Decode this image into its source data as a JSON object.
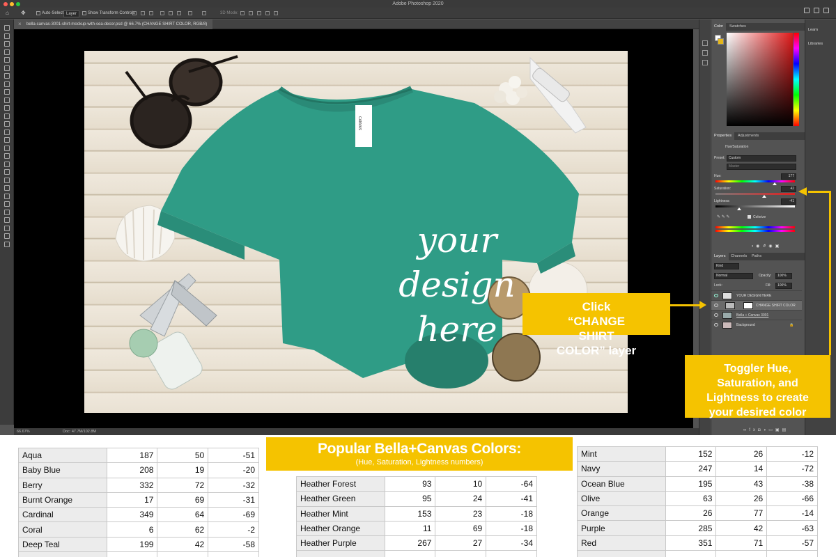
{
  "app": {
    "window_title": "Adobe Photoshop 2020",
    "options_bar": {
      "auto_select_label": "Auto-Select:",
      "auto_select_value": "Layer",
      "transform_label": "Show Transform Controls",
      "mode_label": "3D Mode:"
    },
    "document_tab": "bella-canvas-3001-shirt-mockup-with-sea-decor.psd @ 66.7% (CHANGE SHIRT COLOR, RGB/8)",
    "status": {
      "zoom": "66.67%",
      "doc": "Doc: 47.7M/102.8M"
    },
    "design_text": [
      "your",
      "design",
      "here"
    ],
    "label_tag": "CANVAS"
  },
  "panels": {
    "color": {
      "tabs": [
        "Color",
        "Swatches"
      ],
      "fg_color": "#ffffff",
      "bg_color": "#e5b71a"
    },
    "properties": {
      "tabs": [
        "Properties",
        "Adjustments"
      ],
      "adjustment_name": "Hue/Saturation",
      "preset_label": "Preset:",
      "preset_value": "Custom",
      "channel_value": "Master",
      "hue_label": "Hue:",
      "hue_value": "177",
      "hue_fraction": 0.745,
      "saturation_label": "Saturation:",
      "saturation_value": "42",
      "saturation_fraction": 0.61,
      "lightness_label": "Lightness:",
      "lightness_value": "-41",
      "lightness_fraction": 0.295,
      "colorize_label": "Colorize"
    },
    "layers": {
      "tabs": [
        "Layers",
        "Channels",
        "Paths"
      ],
      "kind_label": "Kind",
      "blend_mode": "Normal",
      "opacity_label": "Opacity:",
      "opacity_value": "100%",
      "lock_label": "Lock:",
      "fill_label": "Fill:",
      "fill_value": "100%",
      "items": [
        {
          "name": "YOUR DESIGN HERE"
        },
        {
          "name": "CHANGE SHIRT COLOR"
        },
        {
          "name": "Bella + Canvas 3001"
        },
        {
          "name": "Background"
        }
      ]
    },
    "learn": [
      "Learn",
      "Libraries"
    ]
  },
  "callouts": {
    "click_layer": "Click “CHANGE SHIRT COLOR” layer",
    "toggle": "Toggler Hue, Saturation, and Lightness to create your desired color",
    "accent_color": "#f5c300"
  },
  "banner": {
    "title": "Popular Bella+Canvas Colors:",
    "subtitle": "(Hue, Saturation, Lightness numbers)"
  },
  "tables": {
    "left": [
      {
        "name": "Aqua",
        "hue": "187",
        "sat": "50",
        "light": "-51"
      },
      {
        "name": "Baby Blue",
        "hue": "208",
        "sat": "19",
        "light": "-20"
      },
      {
        "name": "Berry",
        "hue": "332",
        "sat": "72",
        "light": "-32"
      },
      {
        "name": "Burnt Orange",
        "hue": "17",
        "sat": "69",
        "light": "-31"
      },
      {
        "name": "Cardinal",
        "hue": "349",
        "sat": "64",
        "light": "-69"
      },
      {
        "name": "Coral",
        "hue": "6",
        "sat": "62",
        "light": "-2"
      },
      {
        "name": "Deep Teal",
        "hue": "199",
        "sat": "42",
        "light": "-58"
      }
    ],
    "middle": [
      {
        "name": "Heather Forest",
        "hue": "93",
        "sat": "10",
        "light": "-64"
      },
      {
        "name": "Heather Green",
        "hue": "95",
        "sat": "24",
        "light": "-41"
      },
      {
        "name": "Heather Mint",
        "hue": "153",
        "sat": "23",
        "light": "-18"
      },
      {
        "name": "Heather Orange",
        "hue": "11",
        "sat": "69",
        "light": "-18"
      },
      {
        "name": "Heather Purple",
        "hue": "267",
        "sat": "27",
        "light": "-34"
      }
    ],
    "right": [
      {
        "name": "Mint",
        "hue": "152",
        "sat": "26",
        "light": "-12"
      },
      {
        "name": "Navy",
        "hue": "247",
        "sat": "14",
        "light": "-72"
      },
      {
        "name": "Ocean Blue",
        "hue": "195",
        "sat": "43",
        "light": "-38"
      },
      {
        "name": "Olive",
        "hue": "63",
        "sat": "26",
        "light": "-66"
      },
      {
        "name": "Orange",
        "hue": "26",
        "sat": "77",
        "light": "-14"
      },
      {
        "name": "Purple",
        "hue": "285",
        "sat": "42",
        "light": "-63"
      },
      {
        "name": "Red",
        "hue": "351",
        "sat": "71",
        "light": "-57"
      }
    ]
  }
}
